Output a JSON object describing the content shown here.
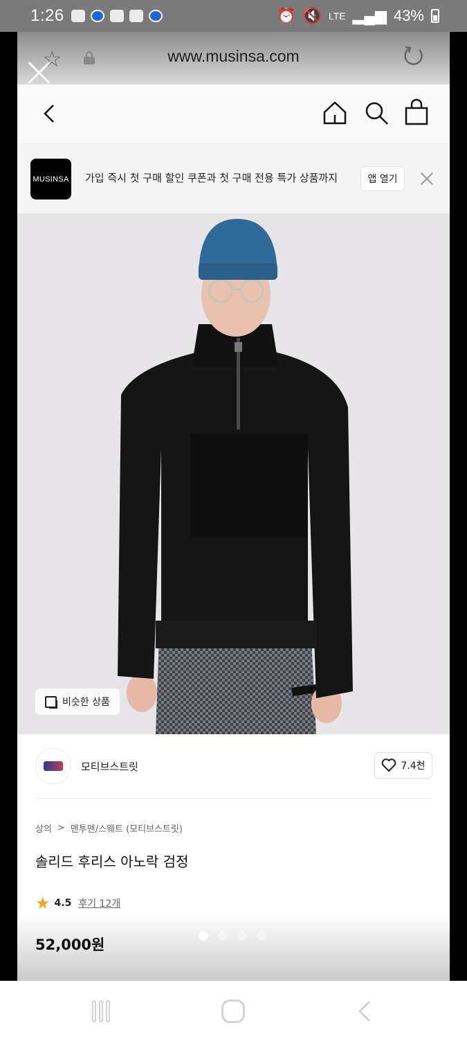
{
  "status_bar": {
    "time": "1:26",
    "network": "LTE",
    "battery": "43%"
  },
  "browser": {
    "url": "www.musinsa.com"
  },
  "app_banner": {
    "logo_text": "MUSINSA",
    "message": "가입 즉시 첫 구매 할인 쿠폰과 첫 구매 전용 특가 상품까지",
    "open_button": "앱 열기"
  },
  "product_image": {
    "similar_button": "비슷한 상품",
    "pages": 4,
    "active_page": 1
  },
  "brand": {
    "name": "모티브스트릿",
    "likes": "7.4천"
  },
  "product": {
    "breadcrumb": [
      "상의",
      "맨투맨/스웨트 (모티브스트릿)"
    ],
    "title": "솔리드 후리스 아노락 검정",
    "rating": "4.5",
    "reviews": "후기 12개",
    "price": "52,000원"
  },
  "colors": {
    "accent_star": "#f2a81d",
    "banner_logo_bg": "#000000"
  }
}
